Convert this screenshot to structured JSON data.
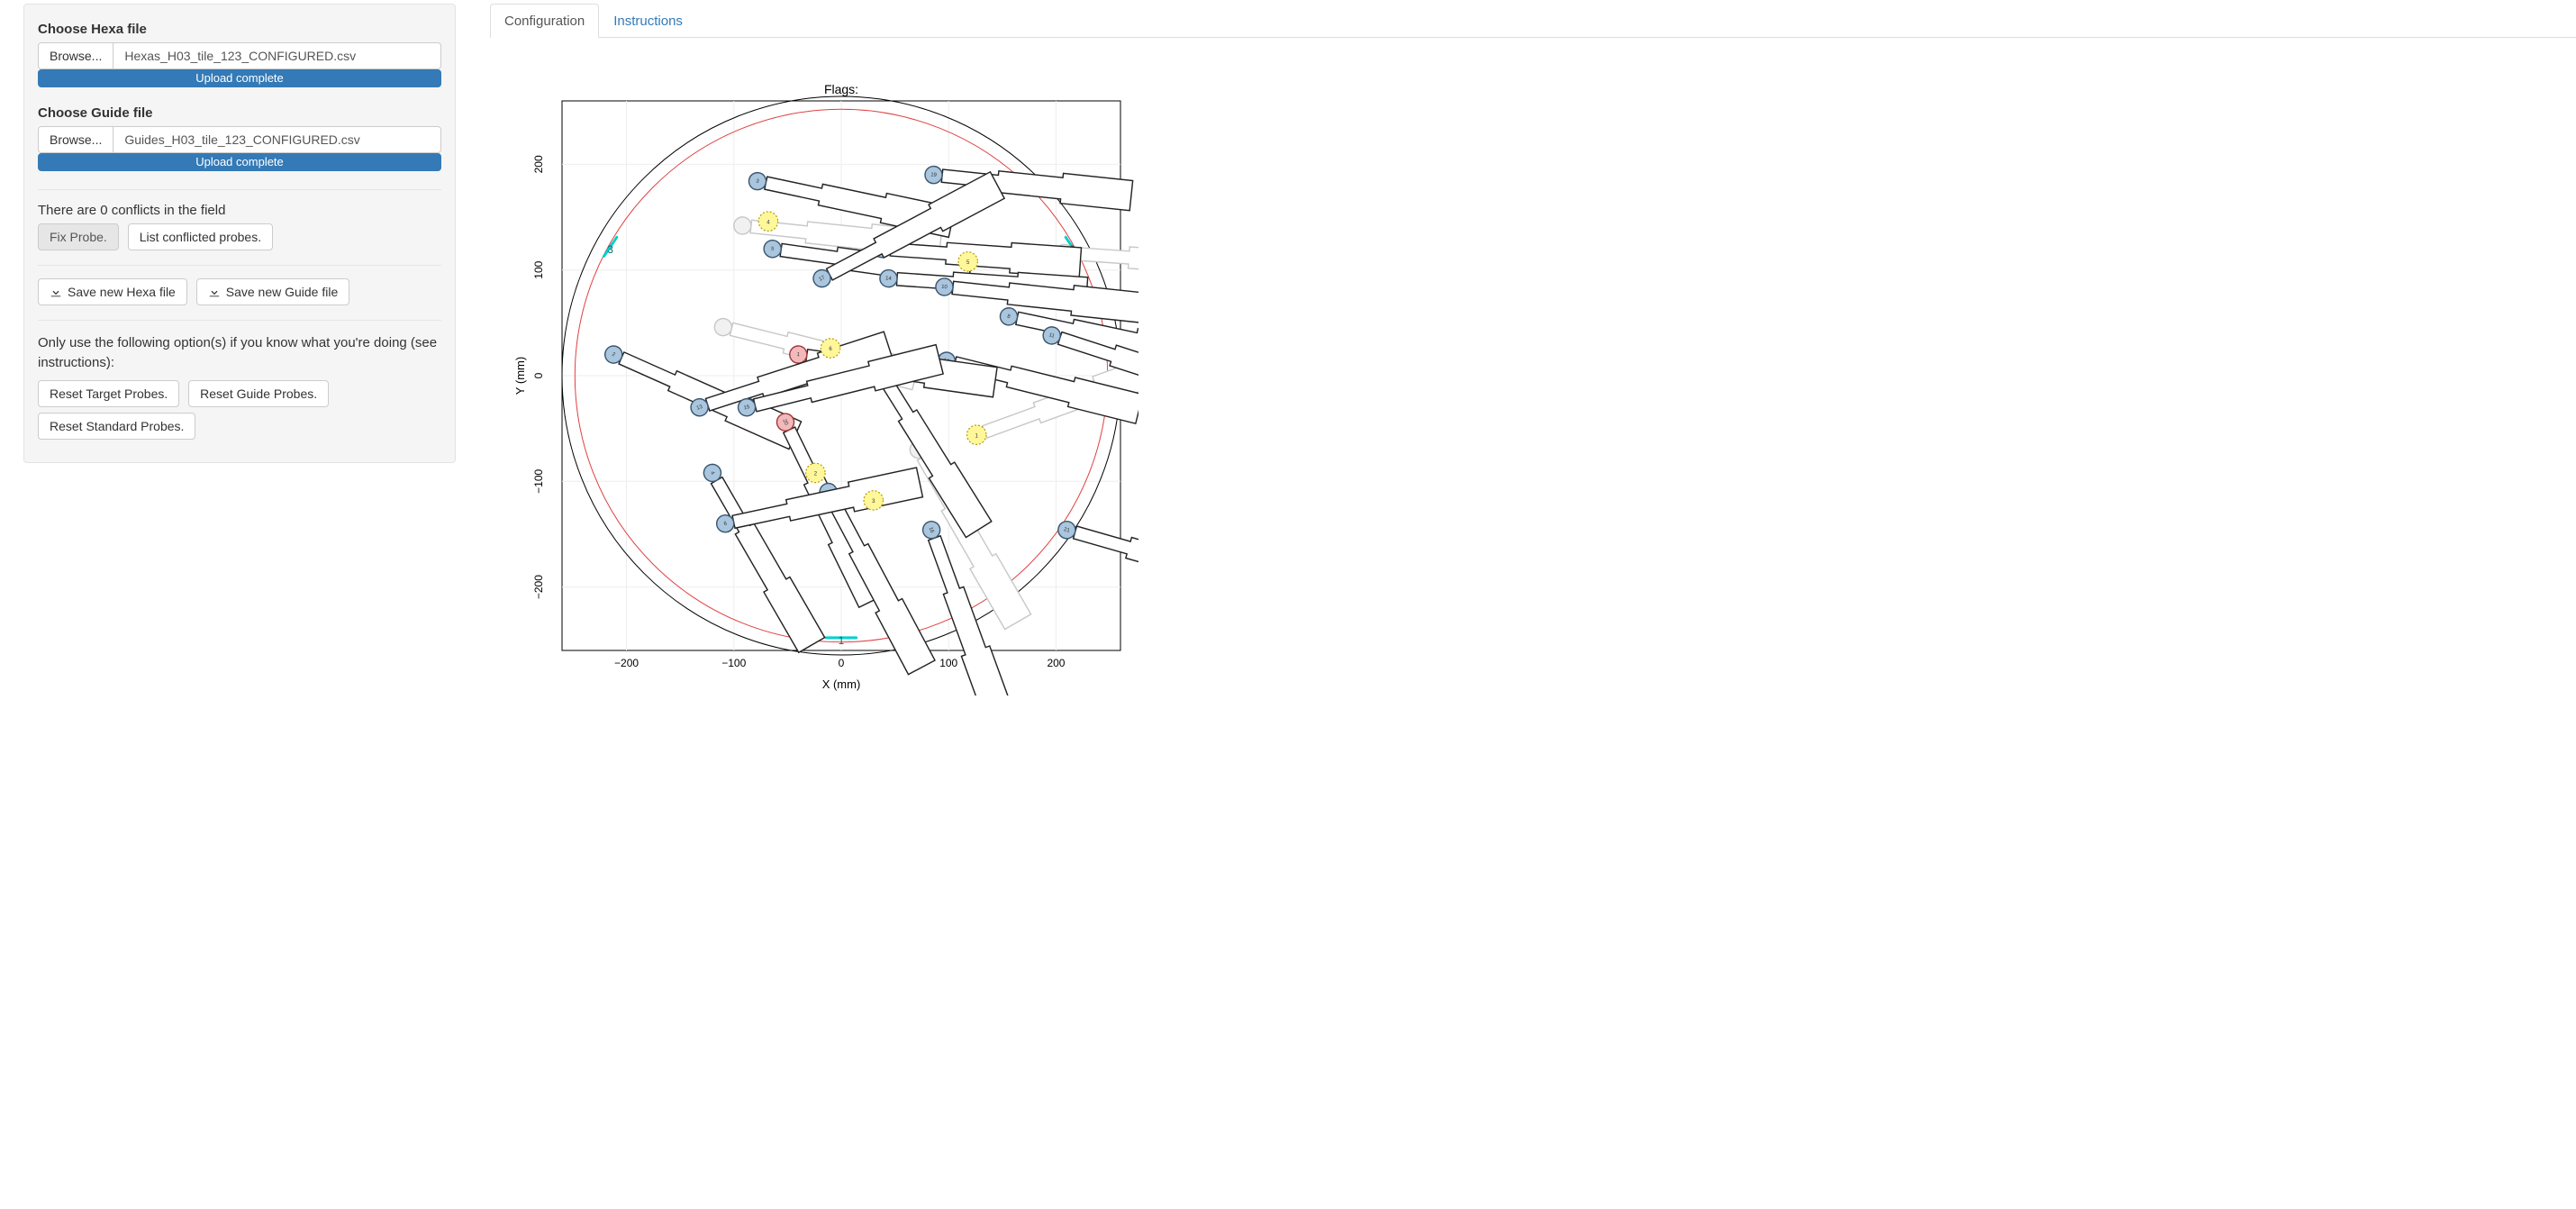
{
  "tabs": {
    "configuration": "Configuration",
    "instructions": "Instructions"
  },
  "hexa": {
    "label": "Choose Hexa file",
    "browse": "Browse...",
    "filename": "Hexas_H03_tile_123_CONFIGURED.csv",
    "progress_text": "Upload complete"
  },
  "guide": {
    "label": "Choose Guide file",
    "browse": "Browse...",
    "filename": "Guides_H03_tile_123_CONFIGURED.csv",
    "progress_text": "Upload complete"
  },
  "conflict_status": "There are 0 conflicts in the field",
  "buttons": {
    "fix_probe": "Fix Probe.",
    "list_conflicted": "List conflicted probes.",
    "save_hexa": "Save new Hexa file",
    "save_guide": "Save new Guide file",
    "reset_target": "Reset Target Probes.",
    "reset_guide": "Reset Guide Probes.",
    "reset_standard": "Reset Standard Probes."
  },
  "warning_text": "Only use the following option(s) if you know what you're doing (see instructions):",
  "chart_data": {
    "type": "scatter",
    "title": "Flags:",
    "xlabel": "X (mm)",
    "ylabel": "Y (mm)",
    "xlim": [
      -260,
      260
    ],
    "ylim": [
      -260,
      260
    ],
    "x_ticks": [
      -200,
      -100,
      0,
      100,
      200
    ],
    "y_ticks": [
      -200,
      -100,
      0,
      100,
      200
    ],
    "field_radius_outer": 260,
    "field_radius_inner": 248,
    "ring_labels": [
      {
        "id": 1,
        "x": 0,
        "y": -248,
        "tick_from": [
          -14,
          -248
        ],
        "tick_to": [
          14,
          -248
        ]
      },
      {
        "id": 2,
        "x": 215,
        "y": 122,
        "tick_from": [
          209,
          131
        ],
        "tick_to": [
          221,
          113
        ]
      },
      {
        "id": 3,
        "x": -215,
        "y": 122,
        "tick_from": [
          -221,
          113
        ],
        "tick_to": [
          -209,
          131
        ]
      }
    ],
    "guides": [
      {
        "id": 1,
        "x": 126,
        "y": -56
      },
      {
        "id": 2,
        "x": -24,
        "y": -92
      },
      {
        "id": 3,
        "x": 30,
        "y": -118
      },
      {
        "id": 4,
        "x": -68,
        "y": 146
      },
      {
        "id": 5,
        "x": 118,
        "y": 108
      },
      {
        "id": 6,
        "x": -10,
        "y": 26
      }
    ],
    "probes": [
      {
        "id": 3,
        "head": {
          "x": -78,
          "y": 184
        },
        "angle_deg": -12,
        "ghost": false,
        "head_color": "blue"
      },
      {
        "id": 19,
        "head": {
          "x": 86,
          "y": 190
        },
        "angle_deg": -6,
        "ghost": false,
        "head_color": "blue"
      },
      {
        "id": 5,
        "head": {
          "x": -64,
          "y": 120
        },
        "angle_deg": -8,
        "ghost": false,
        "head_color": "blue"
      },
      {
        "id": 9,
        "head": {
          "x": 38,
          "y": 120
        },
        "angle_deg": -4,
        "ghost": false,
        "head_color": "blue"
      },
      {
        "id": 17,
        "head": {
          "x": -18,
          "y": 92
        },
        "angle_deg": 28,
        "ghost": false,
        "head_color": "blue"
      },
      {
        "id": 14,
        "head": {
          "x": 44,
          "y": 92
        },
        "angle_deg": -4,
        "ghost": false,
        "head_color": "blue"
      },
      {
        "id": 10,
        "head": {
          "x": 96,
          "y": 84
        },
        "angle_deg": -6,
        "ghost": false,
        "head_color": "blue"
      },
      {
        "id": 8,
        "head": {
          "x": 156,
          "y": 56
        },
        "angle_deg": -12,
        "ghost": false,
        "head_color": "blue"
      },
      {
        "id": 11,
        "head": {
          "x": 196,
          "y": 38
        },
        "angle_deg": -18,
        "ghost": false,
        "head_color": "blue"
      },
      {
        "id": 12,
        "head": {
          "x": 30,
          "y": 14
        },
        "angle_deg": -58,
        "ghost": false,
        "head_color": "blue"
      },
      {
        "id": 18,
        "head": {
          "x": 98,
          "y": 14
        },
        "angle_deg": -14,
        "ghost": false,
        "head_color": "blue"
      },
      {
        "id": 2,
        "head": {
          "x": -212,
          "y": 20
        },
        "angle_deg": -24,
        "ghost": false,
        "head_color": "blue"
      },
      {
        "id": 1,
        "head": {
          "x": -40,
          "y": 20
        },
        "angle_deg": -8,
        "ghost": false,
        "head_color": "red"
      },
      {
        "id": 13,
        "head": {
          "x": -132,
          "y": -30
        },
        "angle_deg": 18,
        "ghost": false,
        "head_color": "blue"
      },
      {
        "id": 15,
        "head": {
          "x": -88,
          "y": -30
        },
        "angle_deg": 14,
        "ghost": false,
        "head_color": "blue"
      },
      {
        "id": 20,
        "head": {
          "x": -52,
          "y": -44
        },
        "angle_deg": -64,
        "ghost": false,
        "head_color": "red"
      },
      {
        "id": 7,
        "head": {
          "x": -12,
          "y": -110
        },
        "angle_deg": -62,
        "ghost": false,
        "head_color": "blue"
      },
      {
        "id": 4,
        "head": {
          "x": -120,
          "y": -92
        },
        "angle_deg": -60,
        "ghost": false,
        "head_color": "blue"
      },
      {
        "id": 6,
        "head": {
          "x": -108,
          "y": -140
        },
        "angle_deg": 12,
        "ghost": false,
        "head_color": "blue"
      },
      {
        "id": 16,
        "head": {
          "x": 84,
          "y": -146
        },
        "angle_deg": -70,
        "ghost": false,
        "head_color": "blue"
      },
      {
        "id": 21,
        "head": {
          "x": 210,
          "y": -146
        },
        "angle_deg": -16,
        "ghost": false,
        "head_color": "blue"
      },
      {
        "id": 101,
        "head": {
          "x": -92,
          "y": 142
        },
        "angle_deg": -6,
        "ghost": true,
        "head_color": "blue"
      },
      {
        "id": 102,
        "head": {
          "x": 72,
          "y": -70
        },
        "angle_deg": -60,
        "ghost": true,
        "head_color": "blue"
      },
      {
        "id": 103,
        "head": {
          "x": 126,
          "y": -56
        },
        "angle_deg": 20,
        "ghost": true,
        "head_color": "blue"
      },
      {
        "id": 104,
        "head": {
          "x": 208,
          "y": 116
        },
        "angle_deg": -4,
        "ghost": true,
        "head_color": "blue"
      },
      {
        "id": 105,
        "head": {
          "x": -110,
          "y": 46
        },
        "angle_deg": -14,
        "ghost": true,
        "head_color": "blue"
      }
    ]
  }
}
